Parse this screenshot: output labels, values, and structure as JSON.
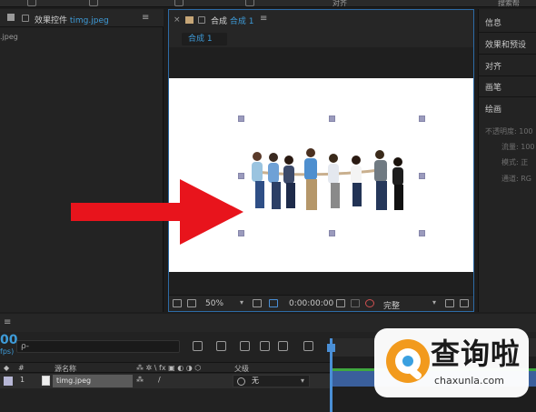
{
  "topbar": {
    "item1": "对齐",
    "item2": "搜索帮"
  },
  "effect_panel": {
    "tab_prefix": "效果控件",
    "tab_file": "timg.jpeg",
    "menu": "≡",
    "sub": ".jpeg"
  },
  "composition": {
    "close": "×",
    "tab_prefix": "合成",
    "tab_name": "合成 1",
    "menu": "≡",
    "breadcrumb": "合成 1",
    "zoom": "50%",
    "timecode": "0:00:00:00",
    "resolution": "完整"
  },
  "right_panel": {
    "items": [
      "信息",
      "效果和预设",
      "对齐",
      "画笔",
      "绘画"
    ],
    "props": [
      "不透明度: 100",
      "流量: 100",
      "模式: 正",
      "通道: RG"
    ]
  },
  "timeline": {
    "timecode_partial": "00",
    "fps_partial": "fps)",
    "search_icon": "ρ-",
    "columns": {
      "num": "#",
      "source": "源名称",
      "parent": "父级"
    },
    "layer": {
      "index": "1",
      "name": "timg.jpeg",
      "parent": "无"
    }
  },
  "watermark": {
    "title": "查询啦",
    "url": "chaxunla.com"
  },
  "colors": {
    "accent_blue": "#3e9bd8",
    "arrow_red": "#e8141c",
    "panel_border_active": "#2d6ba6",
    "layer_bar": "#3a5f9c"
  }
}
